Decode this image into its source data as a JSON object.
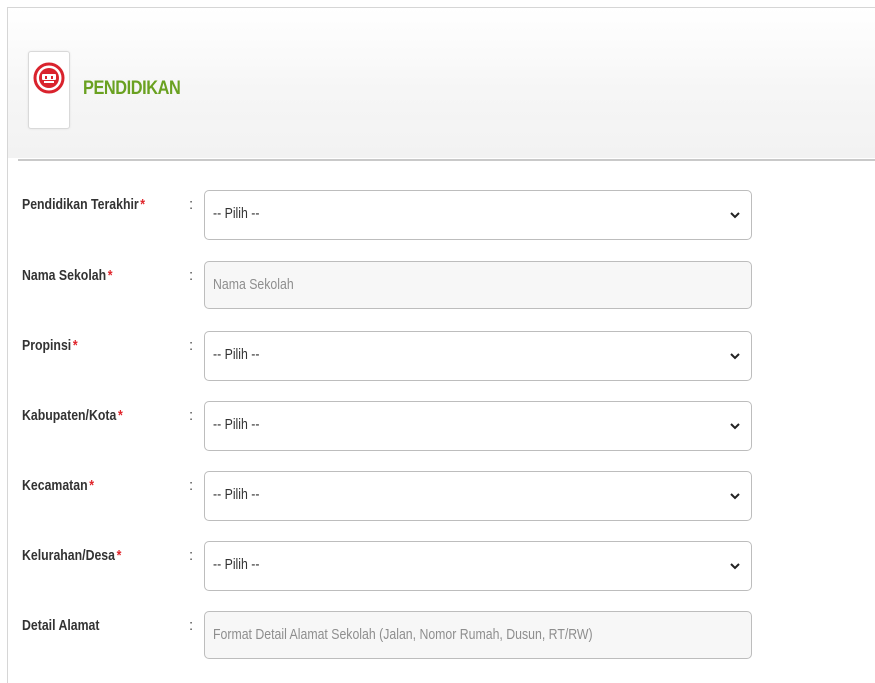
{
  "section": {
    "title": "PENDIDIKAN",
    "icon": "graduation-emblem-icon",
    "accent_color": "#6aa121",
    "icon_color": "#d9232d"
  },
  "form": {
    "required_marker": "*",
    "separator": ":",
    "fields": [
      {
        "label": "Pendidikan Terakhir",
        "required": true,
        "type": "select",
        "value": "-- Pilih --"
      },
      {
        "label": "Nama Sekolah",
        "required": true,
        "type": "text",
        "placeholder": "Nama Sekolah"
      },
      {
        "label": "Propinsi",
        "required": true,
        "type": "select",
        "value": "-- Pilih --"
      },
      {
        "label": "Kabupaten/Kota",
        "required": true,
        "type": "select",
        "value": "-- Pilih --"
      },
      {
        "label": "Kecamatan",
        "required": true,
        "type": "select",
        "value": "-- Pilih --"
      },
      {
        "label": "Kelurahan/Desa",
        "required": true,
        "type": "select",
        "value": "-- Pilih --"
      },
      {
        "label": "Detail Alamat",
        "required": false,
        "type": "text",
        "placeholder": "Format Detail Alamat Sekolah (Jalan, Nomor Rumah, Dusun, RT/RW)"
      }
    ]
  }
}
